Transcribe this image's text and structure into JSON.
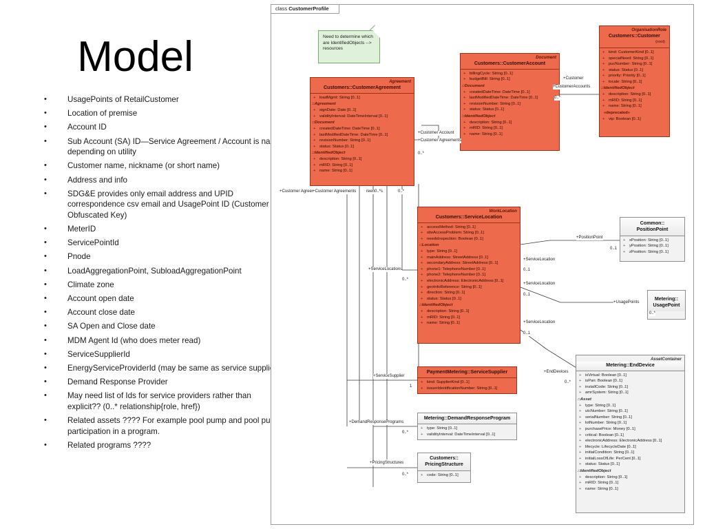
{
  "slide": {
    "title": "Model",
    "bullets": [
      "UsagePoints of RetailCustomer",
      "Location of premise",
      "Account ID",
      "Sub Account (SA) ID—Service Agreement / Account is name depending on utility",
      "Customer name, nickname (or short name)",
      "Address and info",
      "SDG&E provides only email address and UPID correspondence csv email and UsagePoint ID (Customer Obfuscated Key)",
      "MeterID",
      "ServicePointId",
      "Pnode",
      "LoadAggregationPoint, SubloadAggregationPoint",
      "Climate zone",
      "Account open date",
      "Account close date",
      "SA Open and Close date",
      "MDM Agent Id (who does meter read)",
      "ServiceSupplierId",
      "EnergyServiceProviderId (may be same as service supplier)",
      "Demand Response Provider",
      "May need list of Ids for service providers rather than explicit?? (0..* relationship{role, href})",
      "Related assets ???? For example pool pump and pool pump participation in a program.",
      "Related programs ????"
    ]
  },
  "diagram": {
    "tab_kind": "class",
    "tab_name": "CustomerProfile",
    "note": "Need to determine which are IdentifiedObjects --> resources",
    "colors": {
      "class_fill": "#ed6a4c",
      "class_border": "#9a3218",
      "grey_fill": "#f2f2f2",
      "grey_border": "#8d8d8d",
      "note_fill": "#dff0db",
      "note_border": "#7aa96f"
    },
    "classes": [
      {
        "id": "customeragreement",
        "stereotype": "Agreement",
        "name": "Customers::CustomerAgreement",
        "style": "red",
        "rows": [
          {
            "t": "attr",
            "v": "loadMgmt: String [0..1]"
          },
          {
            "t": "grp",
            "v": "::Agreement"
          },
          {
            "t": "attr",
            "v": "signDate: Date [0..1]"
          },
          {
            "t": "attr",
            "v": "validityInterval: DateTimeInterval [0..1]"
          },
          {
            "t": "grp",
            "v": "::Document"
          },
          {
            "t": "attr",
            "v": "createdDateTime: DateTime [0..1]"
          },
          {
            "t": "attr",
            "v": "lastModifiedDateTime: DateTime [0..1]"
          },
          {
            "t": "attr",
            "v": "revisionNumber: String [0..1]"
          },
          {
            "t": "attr",
            "v": "status: Status [0..1]"
          },
          {
            "t": "grp",
            "v": "::IdentifiedObject"
          },
          {
            "t": "attr",
            "v": "description: String [0..1]"
          },
          {
            "t": "attr",
            "v": "mRID: String [0..1]"
          },
          {
            "t": "attr",
            "v": "name: String [0..1]"
          }
        ]
      },
      {
        "id": "customeraccount",
        "stereotype": "Document",
        "name": "Customers::CustomerAccount",
        "style": "red",
        "rows": [
          {
            "t": "attr",
            "v": "billingCycle: String [0..1]"
          },
          {
            "t": "attr",
            "v": "budgetBill: String [0..1]"
          },
          {
            "t": "grp",
            "v": "::Document"
          },
          {
            "t": "attr",
            "v": "createdDateTime: DateTime [0..1]"
          },
          {
            "t": "attr",
            "v": "lastModifiedDateTime: DateTime [0..1]"
          },
          {
            "t": "attr",
            "v": "revisionNumber: String [0..1]"
          },
          {
            "t": "attr",
            "v": "status: Status [0..1]"
          },
          {
            "t": "grp",
            "v": "::IdentifiedObject"
          },
          {
            "t": "attr",
            "v": "description: String [0..1]"
          },
          {
            "t": "attr",
            "v": "mRID: String [0..1]"
          },
          {
            "t": "attr",
            "v": "name: String [0..1]"
          }
        ]
      },
      {
        "id": "customer",
        "stereotype": "OrganisationRole",
        "name": "Customers::Customer",
        "root_note": "(root)",
        "style": "red",
        "rows": [
          {
            "t": "attr",
            "v": "kind: CustomerKind [0..1]"
          },
          {
            "t": "attr",
            "v": "specialNeed: String [0..1]"
          },
          {
            "t": "attr",
            "v": "pucNumber: String [0..1]"
          },
          {
            "t": "attr",
            "v": "status: Status [0..1]"
          },
          {
            "t": "attr",
            "v": "priority: Priority [0..1]"
          },
          {
            "t": "attr",
            "v": "locale: String [0..1]"
          },
          {
            "t": "grp",
            "v": "::IdentifiedObject"
          },
          {
            "t": "attr",
            "v": "description: String [0..1]"
          },
          {
            "t": "attr",
            "v": "mRID: String [0..1]"
          },
          {
            "t": "attr",
            "v": "name: String [0..1]"
          },
          {
            "t": "ster",
            "v": "«deprecated»"
          },
          {
            "t": "attr",
            "v": "vip: Boolean [0..1]"
          }
        ]
      },
      {
        "id": "servicelocation",
        "stereotype": "WorkLocation",
        "name": "Customers::ServiceLocation",
        "style": "red",
        "rows": [
          {
            "t": "attr",
            "v": "accessMethod: String [0..1]"
          },
          {
            "t": "attr",
            "v": "siteAccessProblem: String [0..1]"
          },
          {
            "t": "attr",
            "v": "needsInspection: Boolean [0..1]"
          },
          {
            "t": "grp",
            "v": "::Location"
          },
          {
            "t": "attr",
            "v": "type: String [0..1]"
          },
          {
            "t": "attr",
            "v": "mainAddress: StreetAddress [0..1]"
          },
          {
            "t": "attr",
            "v": "secondaryAddress: StreetAddress [0..1]"
          },
          {
            "t": "attr",
            "v": "phone1: TelephoneNumber [0..1]"
          },
          {
            "t": "attr",
            "v": "phone2: TelephoneNumber [0..1]"
          },
          {
            "t": "attr",
            "v": "electronicAddress: ElectronicAddress [0..1]"
          },
          {
            "t": "attr",
            "v": "geoInfoReference: String [0..1]"
          },
          {
            "t": "attr",
            "v": "direction: String [0..1]"
          },
          {
            "t": "attr",
            "v": "status: Status [0..1]"
          },
          {
            "t": "grp",
            "v": "::IdentifiedObject"
          },
          {
            "t": "attr",
            "v": "description: String [0..1]"
          },
          {
            "t": "attr",
            "v": "mRID: String [0..1]"
          },
          {
            "t": "attr",
            "v": "name: String [0..1]"
          }
        ]
      },
      {
        "id": "positionpoint",
        "name": "Common::\nPositionPoint",
        "name_line1": "Common::",
        "name_line2": "PositionPoint",
        "style": "grey",
        "rows": [
          {
            "t": "attr",
            "v": "xPosition: String [0..1]"
          },
          {
            "t": "attr",
            "v": "yPosition: String [0..1]"
          },
          {
            "t": "attr",
            "v": "zPosition: String [0..1]"
          }
        ]
      },
      {
        "id": "usagepoint",
        "name_line1": "Metering::",
        "name_line2": "UsagePoint",
        "style": "grey",
        "rows": []
      },
      {
        "id": "enddevice",
        "stereotype": "AssetContainer",
        "name": "Metering::EndDevice",
        "style": "grey",
        "rows": [
          {
            "t": "attr",
            "v": "isVirtual: Boolean [0..1]"
          },
          {
            "t": "attr",
            "v": "isPan: Boolean [0..1]"
          },
          {
            "t": "attr",
            "v": "installCode: String [0..1]"
          },
          {
            "t": "attr",
            "v": "amrSystem: String [0..1]"
          },
          {
            "t": "grp",
            "v": "::Asset"
          },
          {
            "t": "attr",
            "v": "type: String [0..1]"
          },
          {
            "t": "attr",
            "v": "utcNumber: String [0..1]"
          },
          {
            "t": "attr",
            "v": "serialNumber: String [0..1]"
          },
          {
            "t": "attr",
            "v": "lotNumber: String [0..1]"
          },
          {
            "t": "attr",
            "v": "purchasePrice: Money [0..1]"
          },
          {
            "t": "attr",
            "v": "critical: Boolean [0..1]"
          },
          {
            "t": "attr",
            "v": "electronicAddress: ElectronicAddress [0..1]"
          },
          {
            "t": "attr",
            "v": "lifecycle: LifecycleDate [0..1]"
          },
          {
            "t": "attr",
            "v": "initialCondition: String [0..1]"
          },
          {
            "t": "attr",
            "v": "initialLossOfLife: PerCent [0..1]"
          },
          {
            "t": "attr",
            "v": "status: Status [0..1]"
          },
          {
            "t": "grp",
            "v": "::IdentifiedObject"
          },
          {
            "t": "attr",
            "v": "description: String [0..1]"
          },
          {
            "t": "attr",
            "v": "mRID: String [0..1]"
          },
          {
            "t": "attr",
            "v": "name: String [0..1]"
          }
        ]
      },
      {
        "id": "servicesupplier",
        "name": "PaymentMetering::ServiceSupplier",
        "style": "red",
        "rows": [
          {
            "t": "attr",
            "v": "kind: SupplierKind [0..1]"
          },
          {
            "t": "attr",
            "v": "issuerIdentificationNumber: String [0..1]"
          }
        ]
      },
      {
        "id": "demandresponseprogram",
        "name": "Metering::DemandResponseProgram",
        "style": "grey",
        "rows": [
          {
            "t": "attr",
            "v": "type: String [0..1]"
          },
          {
            "t": "attr",
            "v": "validityInterval: DateTimeInterval [0..1]"
          }
        ]
      },
      {
        "id": "pricingstructure",
        "name_line1": "Customers::",
        "name_line2": "PricingStructure",
        "style": "grey",
        "rows": [
          {
            "t": "attr",
            "v": "code: String [0..1]"
          }
        ]
      }
    ],
    "connector_labels": [
      {
        "id": "l-customer-role",
        "text": "+Customer"
      },
      {
        "id": "l-customeraccounts-role",
        "text": "+CustomerAccounts"
      },
      {
        "id": "l-customeraccounts-mult",
        "text": "0..*"
      },
      {
        "id": "l-customeraccount-role",
        "text": "+Customer Account"
      },
      {
        "id": "l-customeragreements-role",
        "text": "+Customer Agreements"
      },
      {
        "id": "l-customeragreements-mult",
        "text": "0..*"
      },
      {
        "id": "l-customeragreem-a",
        "text": "+Customer Agreem"
      },
      {
        "id": "l-customeragreements-b",
        "text": "+Customer Agreements"
      },
      {
        "id": "l-reen-c",
        "text": "reen0..*s"
      },
      {
        "id": "l-mult-d",
        "text": "0..*"
      },
      {
        "id": "l-servicelocations-role",
        "text": "+ServiceLocations"
      },
      {
        "id": "l-servicelocations-mult",
        "text": "0..*"
      },
      {
        "id": "l-positionpoint-role",
        "text": "+PositionPoint"
      },
      {
        "id": "l-positionpoint-mult",
        "text": "0..1"
      },
      {
        "id": "l-servicelocation-1",
        "text": "+ServiceLocation"
      },
      {
        "id": "l-servicelocation-1m",
        "text": "0..1"
      },
      {
        "id": "l-servicelocation-2",
        "text": "+ServiceLocation"
      },
      {
        "id": "l-servicelocation-2m",
        "text": "0..1"
      },
      {
        "id": "l-servicelocation-3",
        "text": "+ServiceLocation"
      },
      {
        "id": "l-servicelocation-3m",
        "text": "0..1"
      },
      {
        "id": "l-usagepoints-role",
        "text": "+UsagePoints"
      },
      {
        "id": "l-usagepoints-mult",
        "text": "0..*"
      },
      {
        "id": "l-enddevices-role",
        "text": "+EndDevices"
      },
      {
        "id": "l-enddevices-mult",
        "text": "0..*"
      },
      {
        "id": "l-servicesupplier-role",
        "text": "+ServiceSupplier"
      },
      {
        "id": "l-servicesupplier-mult",
        "text": "1"
      },
      {
        "id": "l-demandresponse-role",
        "text": "+DemandResponsePrograms"
      },
      {
        "id": "l-demandresponse-mult",
        "text": "0..*"
      },
      {
        "id": "l-pricingstructures-role",
        "text": "+PricingStructures"
      },
      {
        "id": "l-pricingstructures-mult",
        "text": "0..*"
      }
    ]
  }
}
